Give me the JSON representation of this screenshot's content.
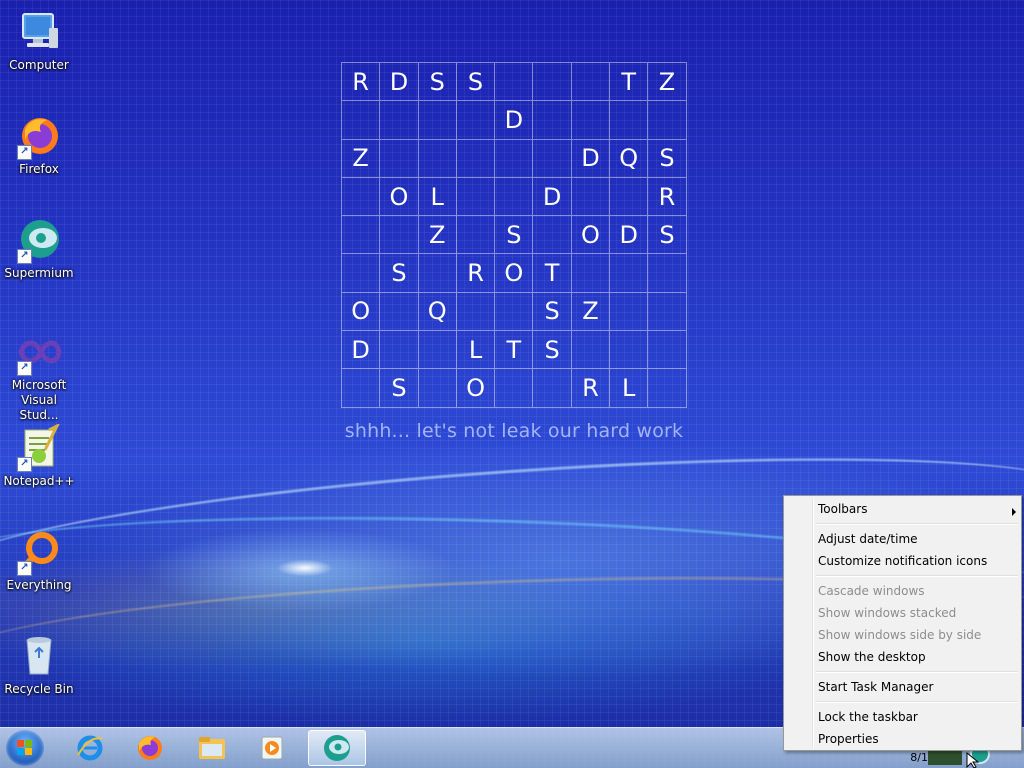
{
  "desktop": {
    "icons": [
      {
        "label": "Computer",
        "icon": "computer-icon"
      },
      {
        "label": "Firefox",
        "icon": "firefox-icon"
      },
      {
        "label": "Supermium",
        "icon": "supermium-icon"
      },
      {
        "label": "Microsoft Visual Stud...",
        "icon": "visual-studio-icon"
      },
      {
        "label": "Notepad++",
        "icon": "notepadpp-icon"
      },
      {
        "label": "Everything",
        "icon": "everything-icon"
      },
      {
        "label": "Recycle Bin",
        "icon": "recycle-bin-icon"
      }
    ],
    "puzzle_rows": [
      [
        "R",
        "D",
        "S",
        "S",
        "",
        "",
        "",
        "T",
        "Z"
      ],
      [
        "",
        "",
        "",
        "",
        "D",
        "",
        "",
        "",
        ""
      ],
      [
        "Z",
        "",
        "",
        "",
        "",
        "",
        "D",
        "Q",
        "S"
      ],
      [
        "",
        "O",
        "L",
        "",
        "",
        "D",
        "",
        "",
        "R"
      ],
      [
        "",
        "",
        "Z",
        "",
        "S",
        "",
        "O",
        "D",
        "S"
      ],
      [
        "",
        "S",
        "",
        "R",
        "O",
        "T",
        "",
        "",
        ""
      ],
      [
        "O",
        "",
        "Q",
        "",
        "",
        "S",
        "Z",
        "",
        ""
      ],
      [
        "D",
        "",
        "",
        "L",
        "T",
        "S",
        "",
        "",
        ""
      ],
      [
        "",
        "S",
        "",
        "O",
        "",
        "",
        "R",
        "L",
        ""
      ]
    ],
    "caption": "shhh... let's not leak our hard work"
  },
  "taskbar": {
    "apps": [
      "internet-explorer-icon",
      "firefox-icon",
      "file-explorer-icon",
      "media-player-icon",
      "supermium-icon"
    ],
    "clock_partial": "8/1"
  },
  "context_menu": {
    "items": [
      {
        "label": "Toolbars",
        "disabled": false,
        "submenu": true
      },
      {
        "label": "Adjust date/time",
        "disabled": false
      },
      {
        "label": "Customize notification icons",
        "disabled": false
      },
      {
        "label": "Cascade windows",
        "disabled": true
      },
      {
        "label": "Show windows stacked",
        "disabled": true
      },
      {
        "label": "Show windows side by side",
        "disabled": true
      },
      {
        "label": "Show the desktop",
        "disabled": false
      },
      {
        "label": "Start Task Manager",
        "disabled": false
      },
      {
        "label": "Lock the taskbar",
        "disabled": false
      },
      {
        "label": "Properties",
        "disabled": false
      }
    ]
  },
  "colors": {
    "wallpaper_blue": "#2436c4",
    "menu_bg": "#f1f1f1",
    "menu_disabled_text": "#8d8d8d"
  }
}
